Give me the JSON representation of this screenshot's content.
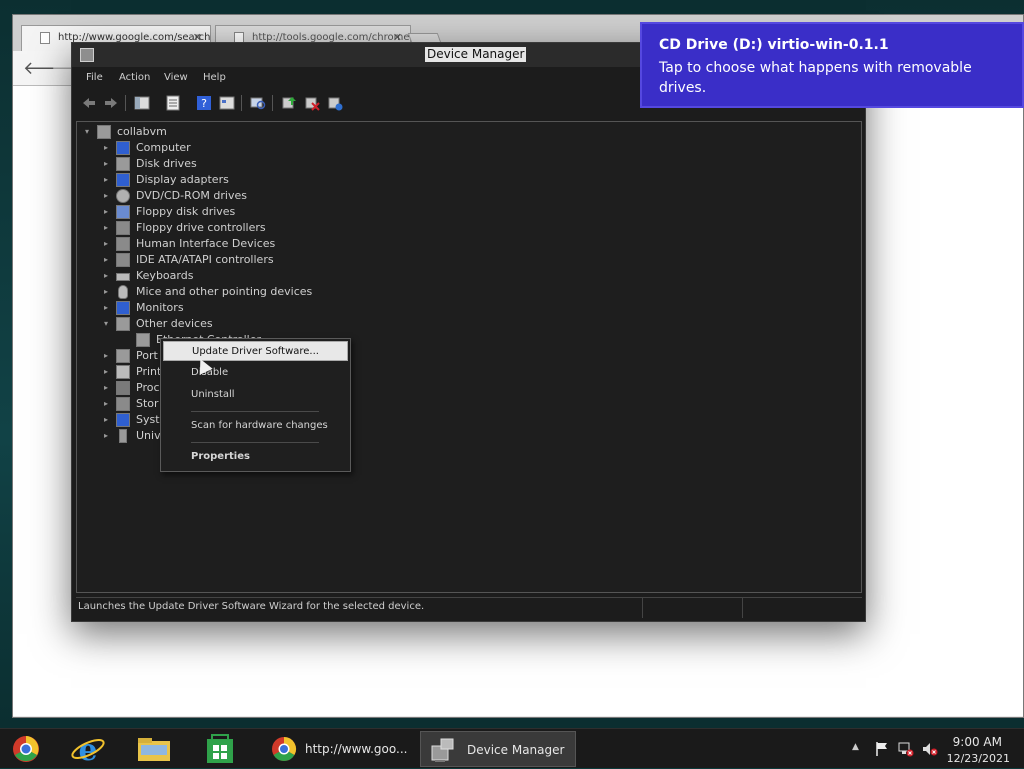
{
  "chrome": {
    "tabs": [
      {
        "label": "http://www.google.com/search",
        "close": "✕"
      },
      {
        "label": "http://tools.google.com/chrome",
        "close": "✕"
      }
    ],
    "back": "🡐",
    "forward": "🡒"
  },
  "device_manager": {
    "title": "Device Manager",
    "menu": [
      "File",
      "Action",
      "View",
      "Help"
    ],
    "tree": {
      "root": "collabvm",
      "items": [
        {
          "label": "Computer",
          "arrow": "▸",
          "color": "#2f5fd0"
        },
        {
          "label": "Disk drives",
          "arrow": "▸",
          "color": "#9a9a9a"
        },
        {
          "label": "Display adapters",
          "arrow": "▸",
          "color": "#2f5fd0"
        },
        {
          "label": "DVD/CD-ROM drives",
          "arrow": "▸",
          "color": "#b0b0b0"
        },
        {
          "label": "Floppy disk drives",
          "arrow": "▸",
          "color": "#6a8bd0"
        },
        {
          "label": "Floppy drive controllers",
          "arrow": "▸",
          "color": "#8a8a8a"
        },
        {
          "label": "Human Interface Devices",
          "arrow": "▸",
          "color": "#8a8a8a"
        },
        {
          "label": "IDE ATA/ATAPI controllers",
          "arrow": "▸",
          "color": "#8a8a8a"
        },
        {
          "label": "Keyboards",
          "arrow": "▸",
          "color": "#bbbbbb"
        },
        {
          "label": "Mice and other pointing devices",
          "arrow": "▸",
          "color": "#bbbbbb"
        },
        {
          "label": "Monitors",
          "arrow": "▸",
          "color": "#2f5fd0"
        },
        {
          "label": "Other devices",
          "arrow": "▾",
          "color": "#9a9a9a"
        }
      ],
      "child_item": "Ethernet Controller",
      "truncated_items": [
        "Port",
        "Print",
        "Proc",
        "Stor",
        "Syst",
        "Univ"
      ]
    },
    "status": "Launches the Update Driver Software Wizard for the selected device."
  },
  "context_menu": {
    "update": "Update Driver Software...",
    "disable": "Disable",
    "uninstall": "Uninstall",
    "scan": "Scan for hardware changes",
    "properties": "Properties"
  },
  "toast": {
    "title": "CD Drive (D:) virtio-win-0.1.1",
    "body": "Tap to choose what happens with removable drives."
  },
  "taskbar": {
    "chrome_task": "http://www.goo...",
    "devmgr_task": "Device Manager",
    "time": "9:00 AM",
    "date": "12/23/2021",
    "tray_arrow": "▲"
  }
}
